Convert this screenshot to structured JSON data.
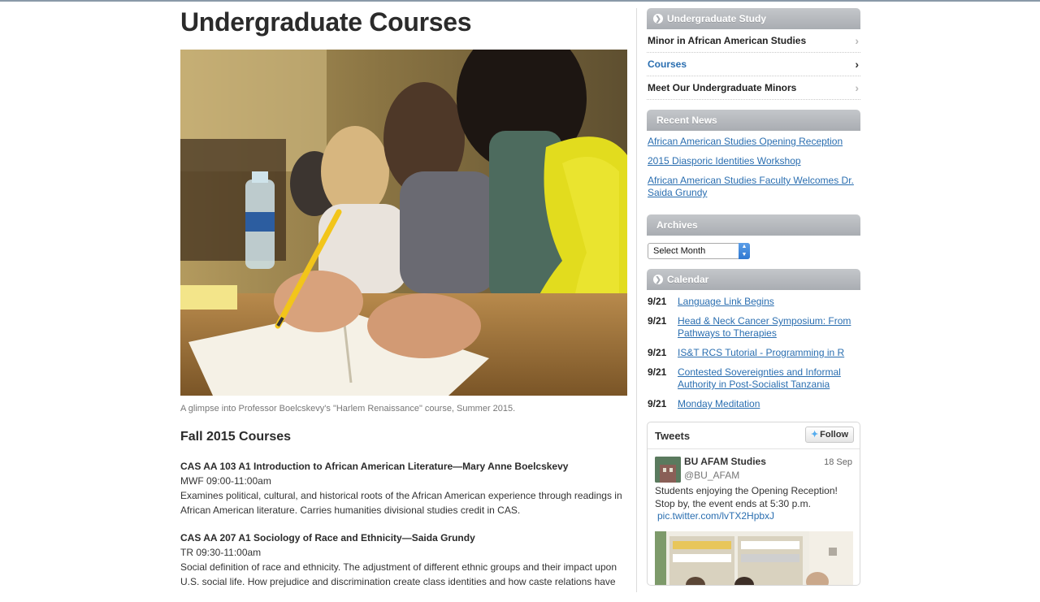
{
  "page": {
    "title": "Undergraduate Courses",
    "caption": "A glimpse into Professor Boelcskevy's \"Harlem Renaissance\" course, Summer 2015.",
    "section_title": "Fall 2015 Courses",
    "courses": [
      {
        "title": "CAS AA 103 A1 Introduction to African American Literature—Mary Anne Boelcskevy",
        "time": "MWF 09:00-11:00am",
        "description": "Examines political, cultural, and historical roots of the African American experience through readings in African American literature. Carries humanities divisional studies credit in CAS."
      },
      {
        "title": "CAS AA 207 A1 Sociology of Race and Ethnicity—Saida Grundy",
        "time": "TR 09:30-11:00am",
        "description": "Social definition of race and ethnicity. The adjustment of different ethnic groups and their impact upon U.S. social life. How prejudice and discrimination create class identities and how caste relations have"
      }
    ]
  },
  "sidebar": {
    "study_header": "Undergraduate Study",
    "nav": [
      {
        "label": "Minor in African American Studies"
      },
      {
        "label": "Courses"
      },
      {
        "label": "Meet Our Undergraduate Minors"
      }
    ],
    "news_header": "Recent News",
    "news": [
      "African American Studies Opening Reception",
      "2015 Diasporic Identities Workshop",
      "African American Studies Faculty Welcomes Dr. Saida Grundy"
    ],
    "archives_header": "Archives",
    "archives_select": "Select Month",
    "calendar_header": "Calendar",
    "calendar": [
      {
        "date": "9/21",
        "title": "Language Link Begins"
      },
      {
        "date": "9/21",
        "title": "Head & Neck Cancer Symposium: From Pathways to Therapies"
      },
      {
        "date": "9/21",
        "title": "IS&T RCS Tutorial - Programming in R"
      },
      {
        "date": "9/21",
        "title": "Contested Sovereignties and Informal Authority in Post-Socialist Tanzania"
      },
      {
        "date": "9/21",
        "title": "Monday Meditation"
      }
    ]
  },
  "tweets": {
    "title": "Tweets",
    "follow": "Follow",
    "author": "BU AFAM Studies",
    "handle": "@BU_AFAM",
    "date": "18 Sep",
    "text": "Students enjoying the Opening Reception! Stop by, the event ends at 5:30 p.m.",
    "link": "pic.twitter.com/lvTX2HpbxJ"
  },
  "icons": {
    "header_circle": "circle-chevron-icon",
    "nav_chevron": "chevron-right-icon",
    "twitter": "twitter-bird-icon"
  }
}
